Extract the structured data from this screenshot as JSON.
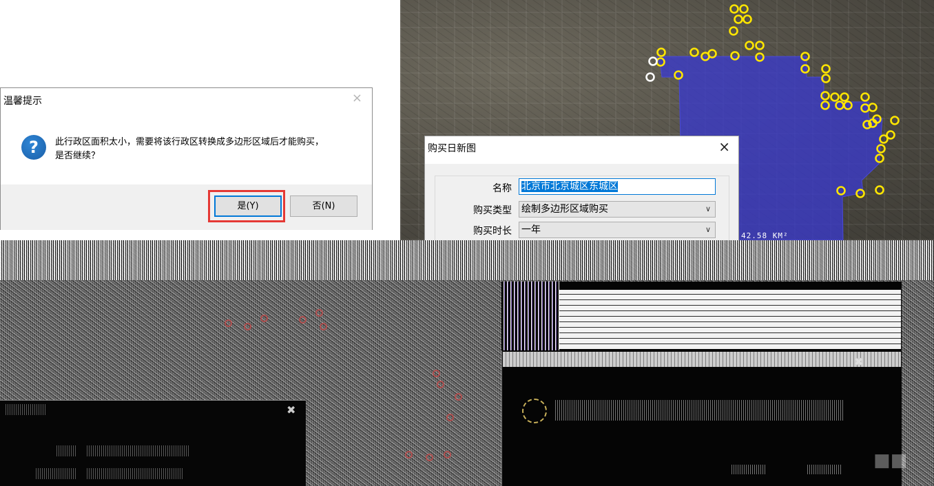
{
  "confirm_dialog": {
    "title": "温馨提示",
    "close_symbol": "×",
    "icon": "question-icon",
    "message_line1": "此行政区面积太小，需要将该行政区转换成多边形区域后才能购买，",
    "message_line2": "是否继续？",
    "yes_label": "是(Y)",
    "no_label": "否(N)",
    "highlight_color": "#e53935"
  },
  "map": {
    "region_color": "#3a3acb",
    "marker_color": "#ffe600",
    "scale_text": "42.58 KM²"
  },
  "purchase_dialog": {
    "title": "购买日新图",
    "close_symbol": "×",
    "name_label": "名称",
    "name_value": "北京市北京城区东城区",
    "type_label": "购买类型",
    "type_value": "绘制多边形区域购买",
    "duration_label": "购买时长",
    "duration_value": "一年"
  },
  "colors": {
    "accent": "#0078d7",
    "dialog_footer": "#f0f0f0"
  }
}
